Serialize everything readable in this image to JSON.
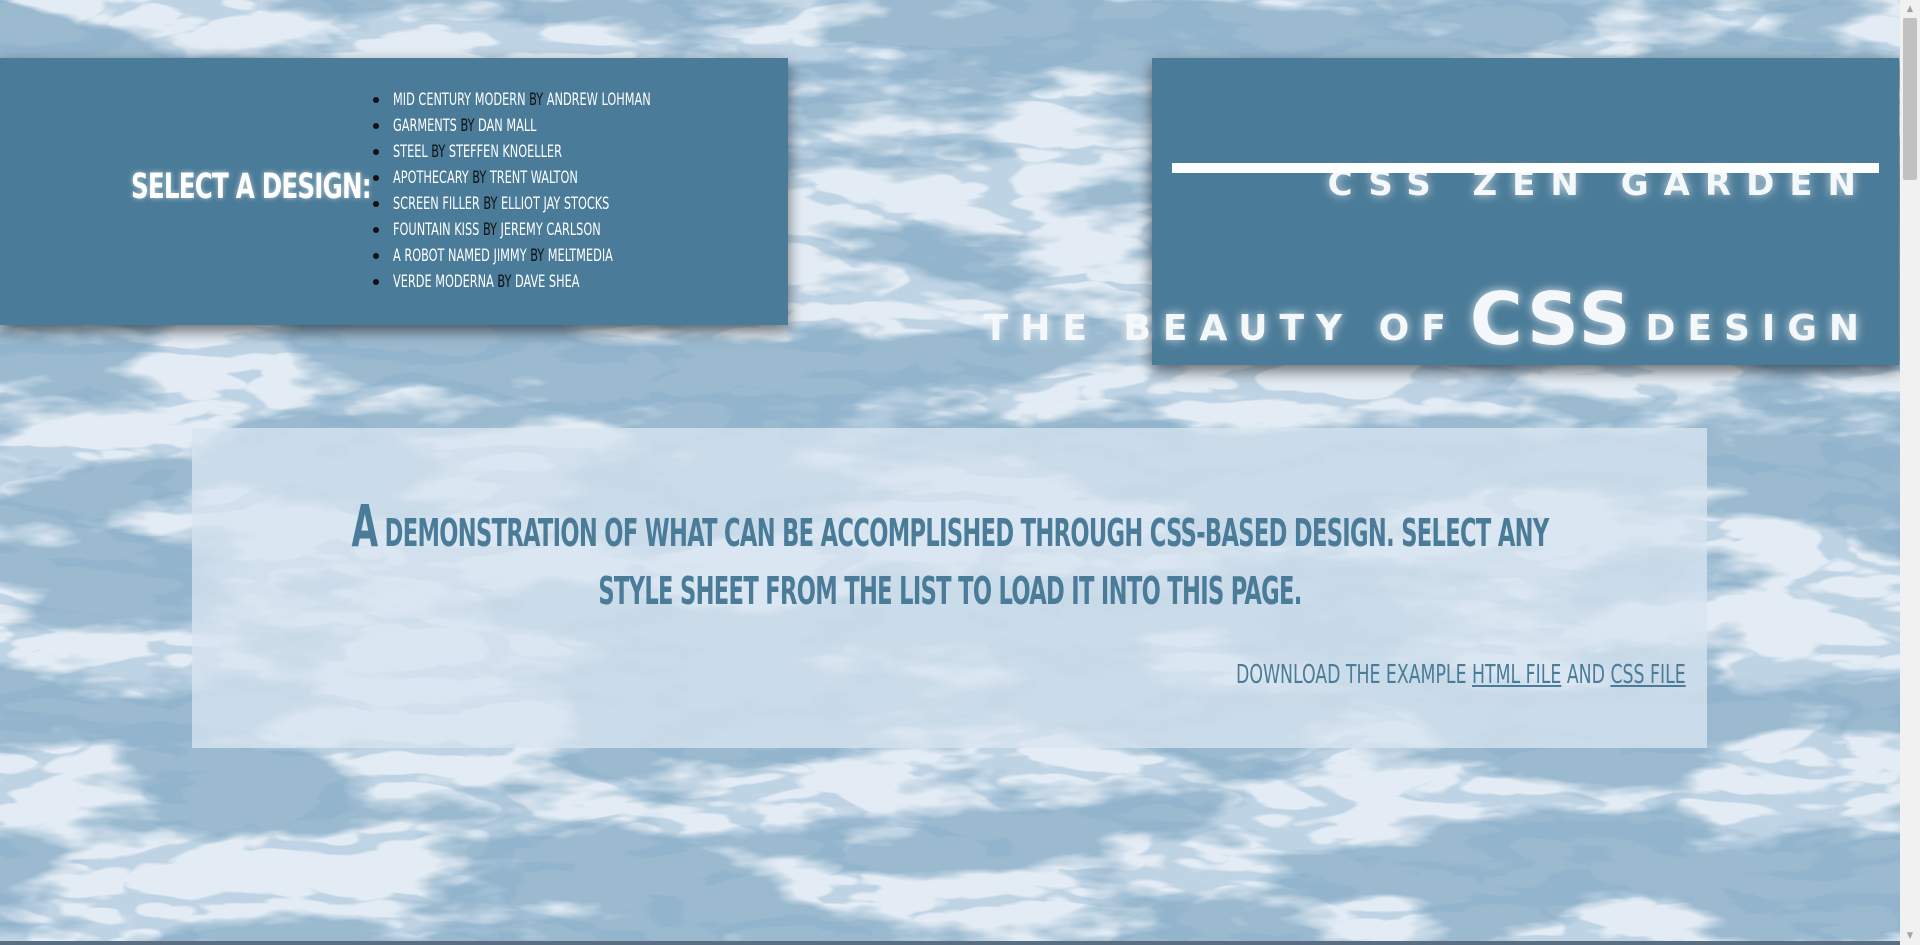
{
  "colors": {
    "panel_blue": "#4a7b98",
    "heading_white": "#ffffff",
    "by_black": "#111111",
    "intro_panel": "#d7e4f0",
    "marble_base": "#dfe8f1"
  },
  "design_selector": {
    "heading": "Select a Design:",
    "by_word": "by",
    "designs": [
      {
        "name": "Mid Century Modern",
        "designer": "Andrew Lohman"
      },
      {
        "name": "Garments",
        "designer": "Dan Mall"
      },
      {
        "name": "Steel",
        "designer": "Steffen Knoeller"
      },
      {
        "name": "Apothecary",
        "designer": "Trent Walton"
      },
      {
        "name": "Screen Filler",
        "designer": "Elliot Jay Stocks"
      },
      {
        "name": "Fountain Kiss",
        "designer": "Jeremy Carlson"
      },
      {
        "name": "A Robot Named Jimmy",
        "designer": "meltmedia"
      },
      {
        "name": "Verde Moderna",
        "designer": "Dave Shea"
      }
    ]
  },
  "header": {
    "title": "CSS Zen Garden",
    "tagline_start": "The Beauty of",
    "tagline_emphasis": "CSS",
    "tagline_end": "Design"
  },
  "intro": {
    "first_letter": "A",
    "summary": "demonstration of what can be accomplished through CSS-based design. Select any style sheet from the list to load it into this page.",
    "download_prefix": "Download the example",
    "html_file_link": "html file",
    "and_word": "and",
    "css_file_link": "css file"
  },
  "icons": {
    "list_bullet": "bullet-icon",
    "scroll_up": "scroll-up-arrow-icon",
    "scroll_down": "scroll-down-arrow-icon"
  }
}
